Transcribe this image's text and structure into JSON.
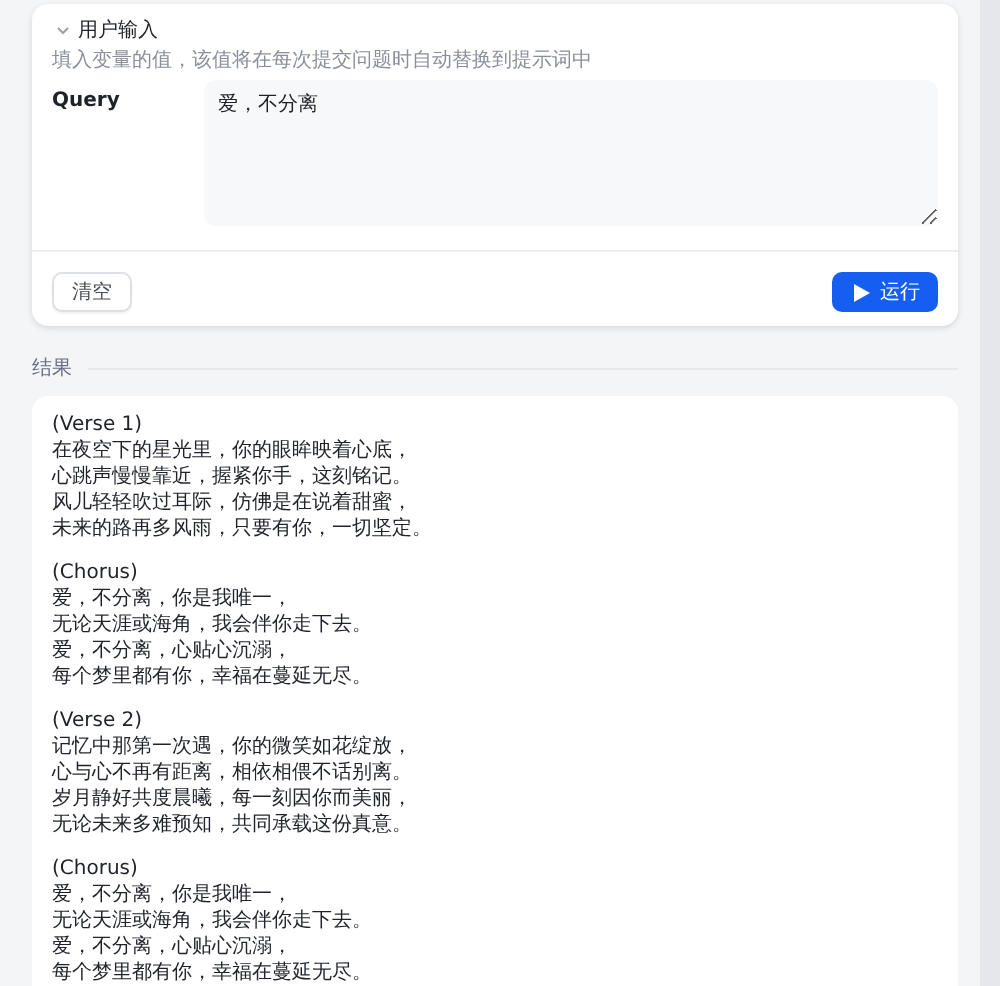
{
  "input_panel": {
    "title": "用户输入",
    "expanded": true,
    "description": "填入变量的值，该值将在每次提交问题时自动替换到提示词中",
    "fields": [
      {
        "label": "Query",
        "value": "爱，不分离"
      }
    ],
    "buttons": [
      {
        "label": "清空",
        "kind": "secondary"
      },
      {
        "label": "运行",
        "kind": "primary"
      }
    ]
  },
  "result": {
    "title": "结果",
    "stanzas": [
      {
        "heading": "(Verse 1)",
        "lines": [
          "在夜空下的星光里，你的眼眸映着心底，",
          "心跳声慢慢靠近，握紧你手，这刻铭记。",
          "风儿轻轻吹过耳际，仿佛是在说着甜蜜，",
          "未来的路再多风雨，只要有你，一切坚定。"
        ]
      },
      {
        "heading": "(Chorus)",
        "lines": [
          "爱，不分离，你是我唯一，",
          "无论天涯或海角，我会伴你走下去。",
          "爱，不分离，心贴心沉溺，",
          "每个梦里都有你，幸福在蔓延无尽。"
        ]
      },
      {
        "heading": "(Verse 2)",
        "lines": [
          "记忆中那第一次遇，你的微笑如花绽放，",
          "心与心不再有距离，相依相偎不话别离。",
          "岁月静好共度晨曦，每一刻因你而美丽，",
          "无论未来多难预知，共同承载这份真意。"
        ]
      },
      {
        "heading": "(Chorus)",
        "lines": [
          "爱，不分离，你是我唯一，",
          "无论天涯或海角，我会伴你走下去。",
          "爱，不分离，心贴心沉溺，",
          "每个梦里都有你，幸福在蔓延无尽。"
        ]
      }
    ]
  }
}
